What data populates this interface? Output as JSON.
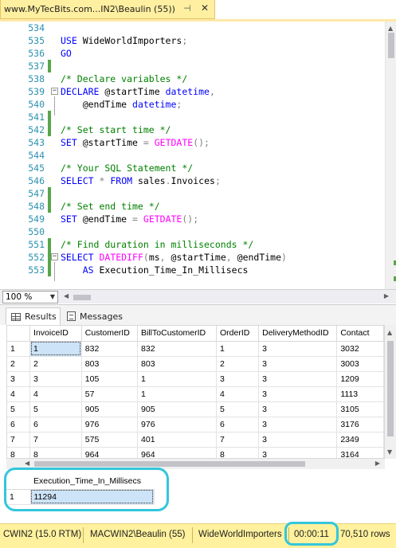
{
  "tab": {
    "title": "www.MyTecBits.com...IN2\\Beaulin (55))",
    "pin": "⊣",
    "close": "✕"
  },
  "editor": {
    "lines": [
      {
        "num": "534",
        "bar": false,
        "fold": "",
        "tokens": []
      },
      {
        "num": "535",
        "bar": false,
        "fold": "",
        "tokens": [
          {
            "t": "kw",
            "v": "USE"
          },
          {
            "t": "",
            "v": " WideWorldImporters"
          },
          {
            "t": "gr",
            "v": ";"
          }
        ]
      },
      {
        "num": "536",
        "bar": false,
        "fold": "",
        "tokens": [
          {
            "t": "kw",
            "v": "GO"
          }
        ]
      },
      {
        "num": "537",
        "bar": true,
        "fold": "",
        "tokens": []
      },
      {
        "num": "538",
        "bar": false,
        "fold": "",
        "tokens": [
          {
            "t": "cm",
            "v": "/* Declare variables */"
          }
        ]
      },
      {
        "num": "539",
        "bar": false,
        "fold": "−",
        "tokens": [
          {
            "t": "kw",
            "v": "DECLARE"
          },
          {
            "t": "",
            "v": " @startTime "
          },
          {
            "t": "kw",
            "v": "datetime"
          },
          {
            "t": "gr",
            "v": ","
          }
        ]
      },
      {
        "num": "540",
        "bar": false,
        "fold": "",
        "tokens": [
          {
            "t": "",
            "v": "    @endTime "
          },
          {
            "t": "kw",
            "v": "datetime"
          },
          {
            "t": "gr",
            "v": ";"
          }
        ]
      },
      {
        "num": "541",
        "bar": true,
        "fold": "",
        "tokens": []
      },
      {
        "num": "542",
        "bar": true,
        "fold": "",
        "tokens": [
          {
            "t": "cm",
            "v": "/* Set start time */"
          }
        ]
      },
      {
        "num": "543",
        "bar": false,
        "fold": "",
        "tokens": [
          {
            "t": "kw",
            "v": "SET"
          },
          {
            "t": "",
            "v": " @startTime "
          },
          {
            "t": "gr",
            "v": "= "
          },
          {
            "t": "fn",
            "v": "GETDATE"
          },
          {
            "t": "gr",
            "v": "();"
          }
        ]
      },
      {
        "num": "544",
        "bar": false,
        "fold": "",
        "tokens": []
      },
      {
        "num": "545",
        "bar": false,
        "fold": "",
        "tokens": [
          {
            "t": "cm",
            "v": "/* Your SQL Statement */"
          }
        ]
      },
      {
        "num": "546",
        "bar": false,
        "fold": "",
        "tokens": [
          {
            "t": "kw",
            "v": "SELECT"
          },
          {
            "t": "",
            "v": " "
          },
          {
            "t": "gr",
            "v": "*"
          },
          {
            "t": "",
            "v": " "
          },
          {
            "t": "kw",
            "v": "FROM"
          },
          {
            "t": "",
            "v": " sales"
          },
          {
            "t": "gr",
            "v": "."
          },
          {
            "t": "",
            "v": "Invoices"
          },
          {
            "t": "gr",
            "v": ";"
          }
        ]
      },
      {
        "num": "547",
        "bar": true,
        "fold": "",
        "tokens": []
      },
      {
        "num": "548",
        "bar": true,
        "fold": "",
        "tokens": [
          {
            "t": "cm",
            "v": "/* Set end time */"
          }
        ]
      },
      {
        "num": "549",
        "bar": false,
        "fold": "",
        "tokens": [
          {
            "t": "kw",
            "v": "SET"
          },
          {
            "t": "",
            "v": " @endTime "
          },
          {
            "t": "gr",
            "v": "= "
          },
          {
            "t": "fn",
            "v": "GETDATE"
          },
          {
            "t": "gr",
            "v": "();"
          }
        ]
      },
      {
        "num": "550",
        "bar": false,
        "fold": "",
        "tokens": []
      },
      {
        "num": "551",
        "bar": true,
        "fold": "",
        "tokens": [
          {
            "t": "cm",
            "v": "/* Find duration in milliseconds */"
          }
        ]
      },
      {
        "num": "552",
        "bar": true,
        "fold": "−",
        "tokens": [
          {
            "t": "kw",
            "v": "SELECT"
          },
          {
            "t": "",
            "v": " "
          },
          {
            "t": "fn",
            "v": "DATEDIFF"
          },
          {
            "t": "gr",
            "v": "("
          },
          {
            "t": "",
            "v": "ms"
          },
          {
            "t": "gr",
            "v": ","
          },
          {
            "t": "",
            "v": " @startTime"
          },
          {
            "t": "gr",
            "v": ","
          },
          {
            "t": "",
            "v": " @endTime"
          },
          {
            "t": "gr",
            "v": ")"
          }
        ]
      },
      {
        "num": "553",
        "bar": true,
        "fold": "",
        "tokens": [
          {
            "t": "",
            "v": "    "
          },
          {
            "t": "kw",
            "v": "AS"
          },
          {
            "t": "",
            "v": " Execution_Time_In_Millisecs"
          }
        ]
      }
    ]
  },
  "zoom": {
    "value": "100 %"
  },
  "results_tabs": {
    "results": "Results",
    "messages": "Messages"
  },
  "grid1": {
    "columns": [
      "InvoiceID",
      "CustomerID",
      "BillToCustomerID",
      "OrderID",
      "DeliveryMethodID",
      "Contact"
    ],
    "rows": [
      [
        "1",
        "1",
        "832",
        "832",
        "1",
        "3",
        "3032"
      ],
      [
        "2",
        "2",
        "803",
        "803",
        "2",
        "3",
        "3003"
      ],
      [
        "3",
        "3",
        "105",
        "1",
        "3",
        "3",
        "1209"
      ],
      [
        "4",
        "4",
        "57",
        "1",
        "4",
        "3",
        "1113"
      ],
      [
        "5",
        "5",
        "905",
        "905",
        "5",
        "3",
        "3105"
      ],
      [
        "6",
        "6",
        "976",
        "976",
        "6",
        "3",
        "3176"
      ],
      [
        "7",
        "7",
        "575",
        "401",
        "7",
        "3",
        "2349"
      ],
      [
        "8",
        "8",
        "964",
        "964",
        "8",
        "3",
        "3164"
      ]
    ]
  },
  "grid2": {
    "column": "Execution_Time_In_Millisecs",
    "rows": [
      [
        "1",
        "11294"
      ]
    ]
  },
  "status": {
    "server": "CWIN2 (15.0 RTM)",
    "user": "MACWIN2\\Beaulin (55)",
    "database": "WideWorldImporters",
    "elapsed": "00:00:11",
    "rows": "70,510 rows"
  },
  "colors": {
    "highlight": "#33c6dc",
    "status_bg": "#fff19d",
    "tab_bg": "#ffefa0"
  }
}
